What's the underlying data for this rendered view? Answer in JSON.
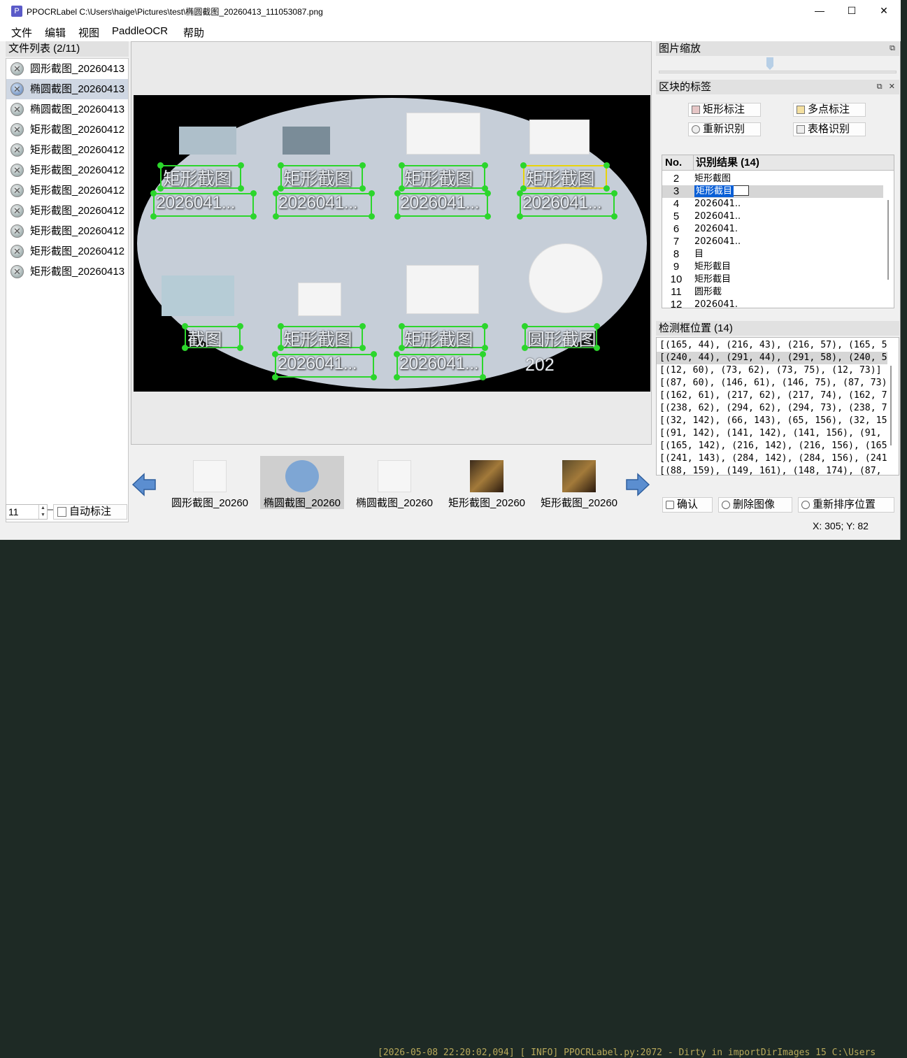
{
  "window": {
    "icon_letter": "P",
    "title": "PPOCRLabel C:\\Users\\haige\\Pictures\\test\\椭圆截图_20260413_111053087.png",
    "min": "—",
    "max": "☐",
    "close": "✕"
  },
  "menu": [
    "文件",
    "编辑",
    "视图",
    "PaddleOCR",
    "帮助"
  ],
  "file_list": {
    "header": "文件列表 (2/11)",
    "items": [
      "圆形截图_20260413",
      "椭圆截图_20260413",
      "椭圆截图_20260413",
      "矩形截图_20260412",
      "矩形截图_20260412",
      "矩形截图_20260412",
      "矩形截图_20260412",
      "矩形截图_20260412",
      "矩形截图_20260412",
      "矩形截图_20260412",
      "矩形截图_20260413"
    ],
    "selected_index": 1
  },
  "bottom_left": {
    "spin_value": "11",
    "auto_label_button": "自动标注"
  },
  "canvas": {
    "labels": [
      "矩形截图",
      "矩形截图",
      "矩形截图",
      "矩形截图",
      "2026041...",
      "2026041...",
      "2026041...",
      "2026041...",
      "截图",
      "矩形截图",
      "矩形截图",
      "圆形截图",
      "2026041...",
      "2026041..."
    ],
    "partial_text": "202"
  },
  "thumbnails": [
    {
      "caption": "圆形截图_20260",
      "selected": false
    },
    {
      "caption": "椭圆截图_20260",
      "selected": true
    },
    {
      "caption": "椭圆截图_20260",
      "selected": false
    },
    {
      "caption": "矩形截图_20260",
      "selected": false
    },
    {
      "caption": "矩形截图_20260",
      "selected": false
    }
  ],
  "zoom_panel": {
    "title": "图片缩放"
  },
  "label_panel": {
    "title": "区块的标签",
    "buttons": {
      "rect": "矩形标注",
      "poly": "多点标注",
      "rerecognize": "重新识别",
      "table": "表格识别"
    }
  },
  "results": {
    "col_no": "No.",
    "col_result": "识别结果 (14)",
    "rows": [
      {
        "no": "2",
        "text": "矩形截图"
      },
      {
        "no": "3",
        "text": "矩形截目"
      },
      {
        "no": "4",
        "text": "2026041.."
      },
      {
        "no": "5",
        "text": "2026041.."
      },
      {
        "no": "6",
        "text": "2026041."
      },
      {
        "no": "7",
        "text": "2026041.."
      },
      {
        "no": "8",
        "text": "目"
      },
      {
        "no": "9",
        "text": "矩形截目"
      },
      {
        "no": "10",
        "text": "矩形截目"
      },
      {
        "no": "11",
        "text": "圆形截"
      },
      {
        "no": "12",
        "text": "2026041."
      }
    ],
    "selected_no": "3"
  },
  "bbox_panel": {
    "title": "检测框位置 (14)",
    "rows": [
      "[(165, 44), (216, 43), (216, 57), (165, 5",
      "[(240, 44), (291, 44), (291, 58), (240, 5",
      "[(12, 60), (73, 62), (73, 75), (12, 73)]",
      "[(87, 60), (146, 61), (146, 75), (87, 73)",
      "[(162, 61), (217, 62), (217, 74), (162, 7",
      "[(238, 62), (294, 62), (294, 73), (238, 7",
      "[(32, 142), (66, 143), (65, 156), (32, 15",
      "[(91, 142), (141, 142), (141, 156), (91,",
      "[(165, 142), (216, 142), (216, 156), (165",
      "[(241, 143), (284, 142), (284, 156), (241",
      "[(88, 159), (149, 161), (148, 174), (87,"
    ],
    "selected_index": 1
  },
  "footer_buttons": {
    "confirm": "确认",
    "delete_image": "删除图像",
    "resort": "重新排序位置"
  },
  "status": "X: 305; Y: 82",
  "background_terminal": "[2026-05-08 22:20:02,094] [    INFO] PPOCRLabel.py:2072 - Dirty in importDirImages 15 C:\\Users"
}
